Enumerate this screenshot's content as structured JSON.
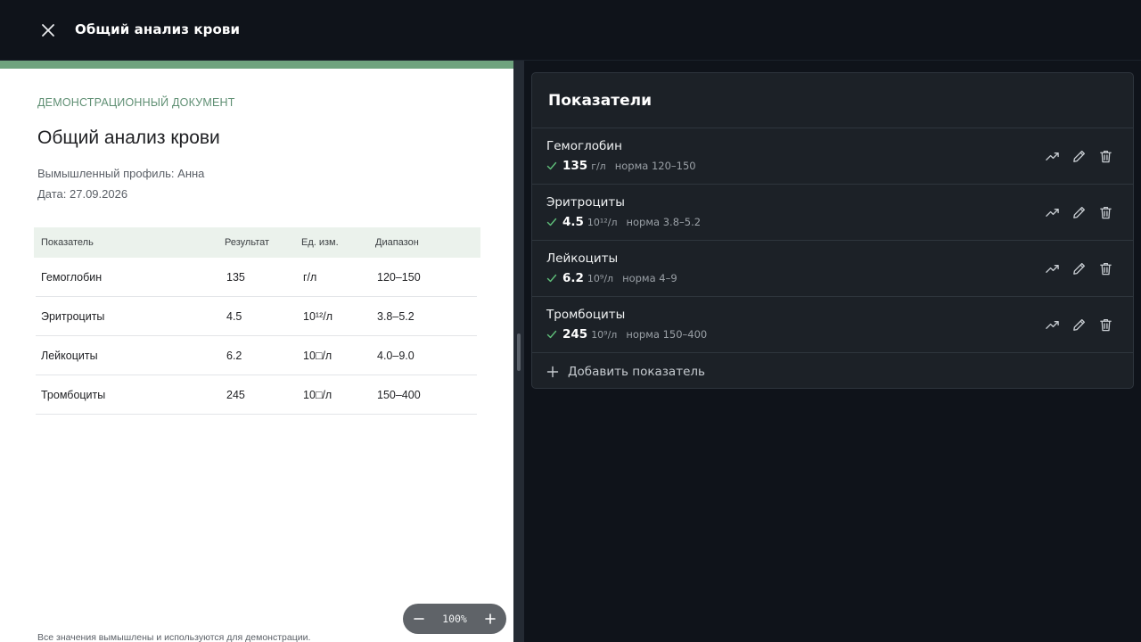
{
  "header": {
    "title": "Общий анализ крови",
    "close_icon": "close-icon"
  },
  "document": {
    "kicker": "ДЕМОНСТРАЦИОННЫЙ ДОКУМЕНТ",
    "title": "Общий анализ крови",
    "profile": "Вымышленный профиль: Анна",
    "date": "Дата: 27.09.2026",
    "accent_color": "#6fa37e",
    "table": {
      "headers": [
        "Показатель",
        "Результат",
        "Ед. изм.",
        "Диапазон"
      ],
      "rows": [
        [
          "Гемоглобин",
          "135",
          "г/л",
          "120–150"
        ],
        [
          "Эритроциты",
          "4.5",
          "10¹²/л",
          "3.8–5.2"
        ],
        [
          "Лейкоциты",
          "6.2",
          "10□/л",
          "4.0–9.0"
        ],
        [
          "Тромбоциты",
          "245",
          "10□/л",
          "150–400"
        ]
      ]
    },
    "footer": "Все значения вымышлены и используются для демонстрации.",
    "zoom": {
      "level": "100%",
      "zoom_out_icon": "minus-icon",
      "zoom_in_icon": "plus-icon"
    }
  },
  "panel": {
    "title": "Показатели",
    "metrics": [
      {
        "name": "Гемоглобин",
        "value": "135",
        "unit": "г/л",
        "range": "норма 120–150",
        "status_icon": "check-icon"
      },
      {
        "name": "Эритроциты",
        "value": "4.5",
        "unit": "10¹²/л",
        "range": "норма 3.8–5.2",
        "status_icon": "check-icon"
      },
      {
        "name": "Лейкоциты",
        "value": "6.2",
        "unit": "10⁹/л",
        "range": "норма 4–9",
        "status_icon": "check-icon"
      },
      {
        "name": "Тромбоциты",
        "value": "245",
        "unit": "10⁹/л",
        "range": "норма 150–400",
        "status_icon": "check-icon"
      }
    ],
    "row_action_icons": [
      "trend-icon",
      "edit-pencil-icon",
      "trash-icon"
    ],
    "add_label": "Добавить показатель",
    "status_color": "#5fbf7a"
  }
}
